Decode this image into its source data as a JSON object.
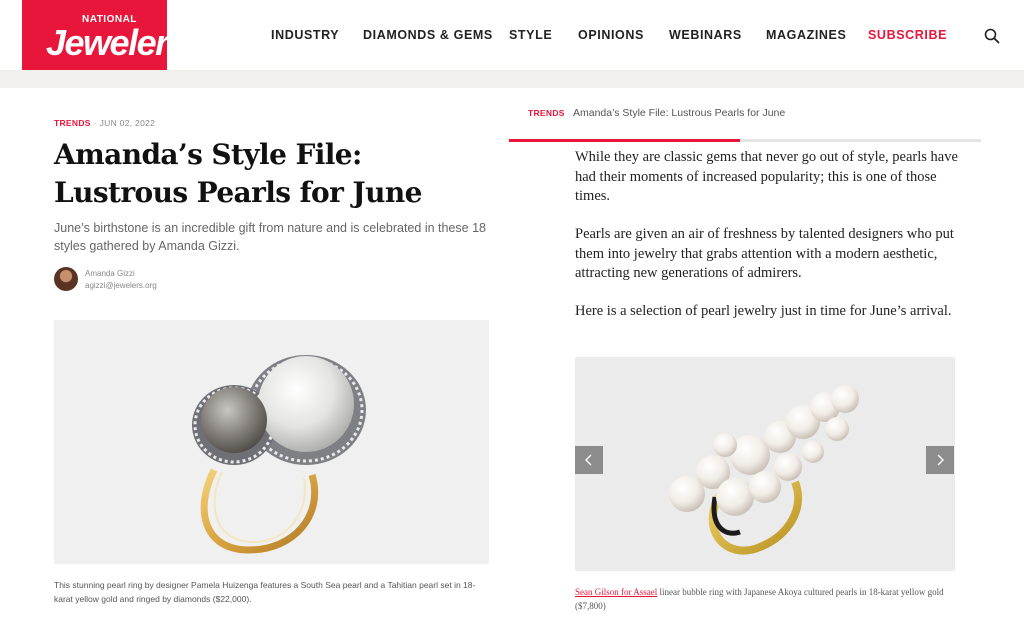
{
  "brand": {
    "top": "NATIONAL",
    "name": "Jeweler",
    "color": "#e8163b"
  },
  "nav": [
    {
      "label": "INDUSTRY"
    },
    {
      "label": "DIAMONDS & GEMS"
    },
    {
      "label": "STYLE"
    },
    {
      "label": "OPINIONS"
    },
    {
      "label": "WEBINARS"
    },
    {
      "label": "MAGAZINES"
    },
    {
      "label": "SUBSCRIBE"
    }
  ],
  "search_icon": "search-icon",
  "article": {
    "category": "TRENDS",
    "date": "JUN 02, 2022",
    "title": "Amanda’s Style File: Lustrous Pearls for June",
    "dek": "June’s birthstone is an incredible gift from nature and is celebrated in these 18 styles gathered by Amanda Gizzi.",
    "author": {
      "name": "Amanda Gizzi",
      "email": "agizzi@jewelers.org"
    },
    "lead_image_caption": "This stunning pearl ring by designer Pamela Huizenga features a South Sea pearl and a Tahitian pearl set in 18-karat yellow gold and ringed by diamonds ($22,000)."
  },
  "reading_bar": {
    "category": "TRENDS",
    "title": "Amanda’s Style File: Lustrous Pearls for June",
    "progress": 0.49
  },
  "body": {
    "p1": "While they are classic gems that never go out of style, pearls have had their moments of increased popularity; this is one of those times.",
    "p2": "Pearls are given an air of freshness by talented designers who put them into jewelry that grabs attention with a modern aesthetic, attracting new generations of admirers.",
    "p3": "Here is a selection of pearl jewelry just in time for June’s arrival."
  },
  "slideshow": {
    "prev_icon": "chevron-left-icon",
    "next_icon": "chevron-right-icon",
    "caption_link": "Sean Gilson for Assael",
    "caption_text": " linear bubble ring with Japanese Akoya cultured pearls in 18-karat yellow gold ($7,800)"
  }
}
